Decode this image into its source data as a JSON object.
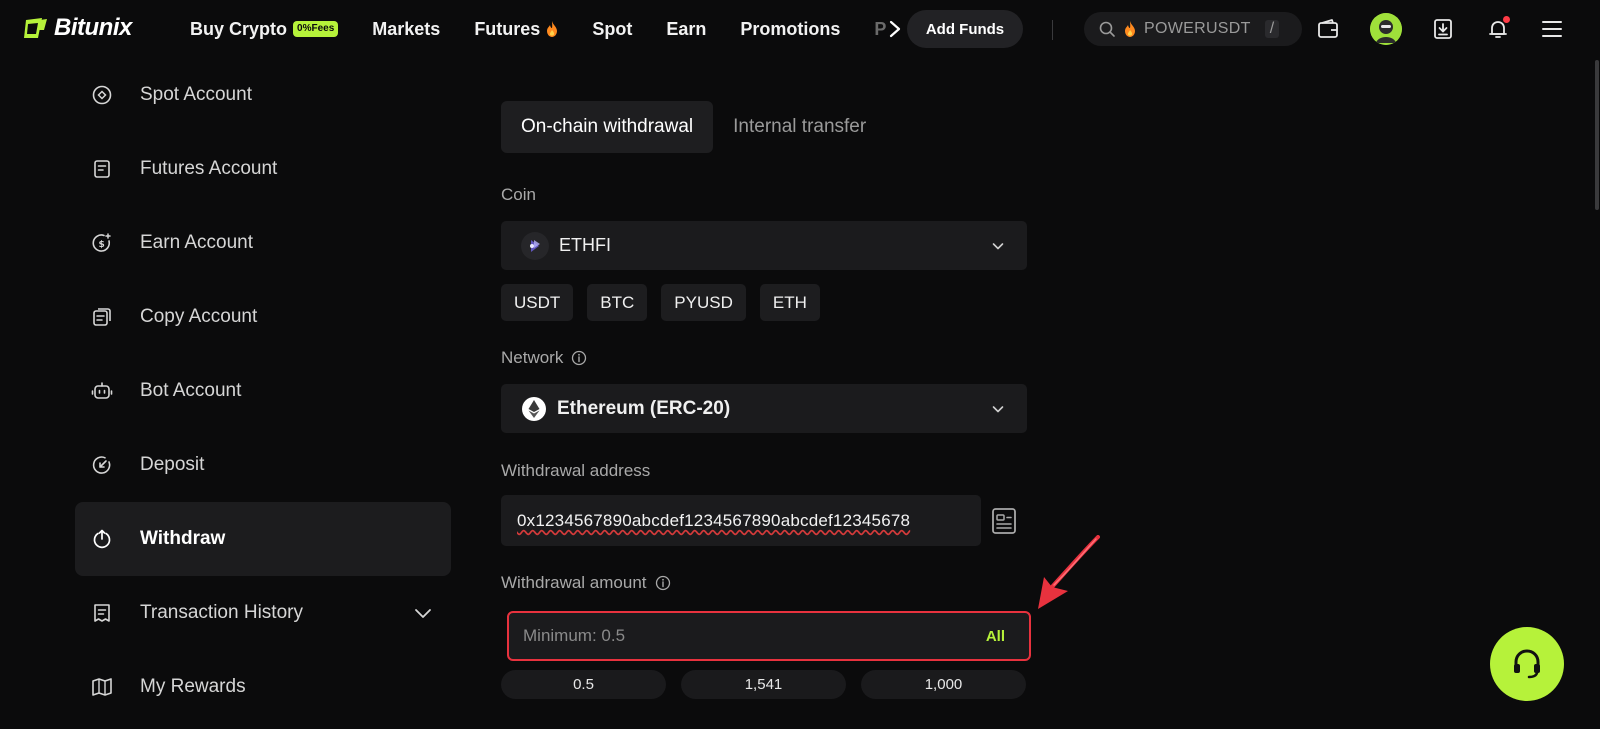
{
  "brand": {
    "name": "Bitunix"
  },
  "nav": {
    "items": [
      {
        "label": "Buy Crypto",
        "badge": "0%Fees"
      },
      {
        "label": "Markets"
      },
      {
        "label": "Futures",
        "icon": "fire-icon"
      },
      {
        "label": "Spot"
      },
      {
        "label": "Earn"
      },
      {
        "label": "Promotions"
      }
    ],
    "overflow_text": "P",
    "add_funds": "Add Funds",
    "search": {
      "text": "POWERUSDT",
      "shortcut": "/"
    }
  },
  "sidebar": {
    "items": [
      {
        "label": "Spot Account",
        "icon": "target-icon"
      },
      {
        "label": "Futures Account",
        "icon": "document-icon"
      },
      {
        "label": "Earn Account",
        "icon": "dollar-coin-icon"
      },
      {
        "label": "Copy Account",
        "icon": "copy-icon"
      },
      {
        "label": "Bot Account",
        "icon": "bot-icon"
      },
      {
        "label": "Deposit",
        "icon": "deposit-icon"
      },
      {
        "label": "Withdraw",
        "icon": "withdraw-icon",
        "active": true
      },
      {
        "label": "Transaction History",
        "icon": "receipt-icon",
        "expandable": true
      },
      {
        "label": "My Rewards",
        "icon": "rewards-icon"
      }
    ]
  },
  "form": {
    "tabs": [
      {
        "label": "On-chain withdrawal",
        "active": true
      },
      {
        "label": "Internal transfer"
      }
    ],
    "coin_label": "Coin",
    "coin_value": "ETHFI",
    "coin_chips": [
      "USDT",
      "BTC",
      "PYUSD",
      "ETH"
    ],
    "network_label": "Network",
    "network_value": "Ethereum (ERC-20)",
    "address_label": "Withdrawal address",
    "address_value": "0x1234567890abcdef1234567890abcdef12345678",
    "amount_label": "Withdrawal amount",
    "amount_placeholder": "Minimum: 0.5",
    "amount_all": "All",
    "quick_amounts": [
      "0.5",
      "1,541",
      "1,000"
    ]
  },
  "colors": {
    "accent": "#b6f23a",
    "highlight_border": "#e8323e",
    "background": "#0b0b0c"
  }
}
